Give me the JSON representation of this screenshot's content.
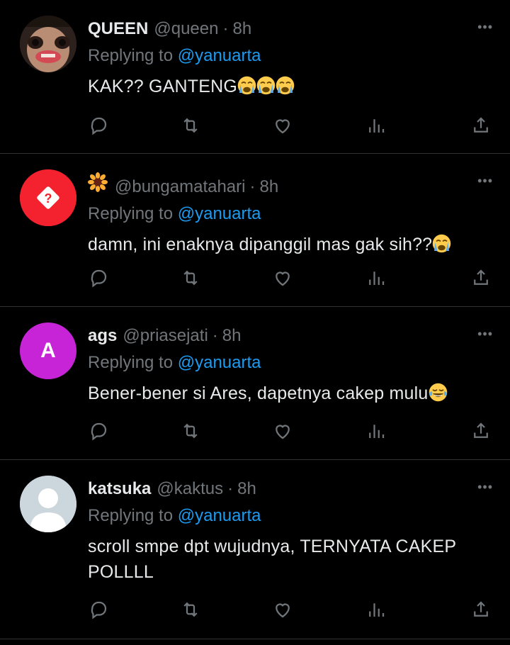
{
  "tweets": [
    {
      "name": "QUEEN",
      "handle": "@queen",
      "time": "8h",
      "replying_label": "Replying to",
      "replying_to": "@yanuarta",
      "text": "KAK?? GANTENG",
      "avatar": "photo",
      "emojis": [
        "crying-face",
        "crying-face",
        "crying-face"
      ]
    },
    {
      "name": "",
      "name_emoji": "sunflower",
      "handle": "@bungamatahari",
      "time": "8h",
      "replying_label": "Replying to",
      "replying_to": "@yanuarta",
      "text": "damn, ini enaknya dipanggil mas gak sih??",
      "avatar": "unavailable",
      "emojis": [
        "crying-face"
      ]
    },
    {
      "name": "ags",
      "handle": "@priasejati",
      "time": "8h",
      "replying_label": "Replying to",
      "replying_to": "@yanuarta",
      "text": "Bener-bener si Ares, dapetnya cakep mulu",
      "avatar": "letter",
      "avatar_letter": "A",
      "emojis": [
        "tears-of-joy"
      ]
    },
    {
      "name": "katsuka",
      "handle": "@kaktus",
      "time": "8h",
      "replying_label": "Replying to",
      "replying_to": "@yanuarta",
      "text": "scroll smpe dpt wujudnya, TERNYATA CAKEP POLLLL",
      "avatar": "default",
      "emojis": []
    }
  ],
  "colors": {
    "background": "#000000",
    "text": "#e7e9ea",
    "muted": "#71767b",
    "link": "#1d9bf0",
    "divider": "#2f3336",
    "avatar_red": "#f4212e",
    "avatar_purple": "#c724d8",
    "avatar_default": "#ccd6dd"
  },
  "action_icons": [
    "reply-icon",
    "retweet-icon",
    "like-icon",
    "views-icon",
    "share-icon"
  ],
  "more_icon": "more-icon"
}
